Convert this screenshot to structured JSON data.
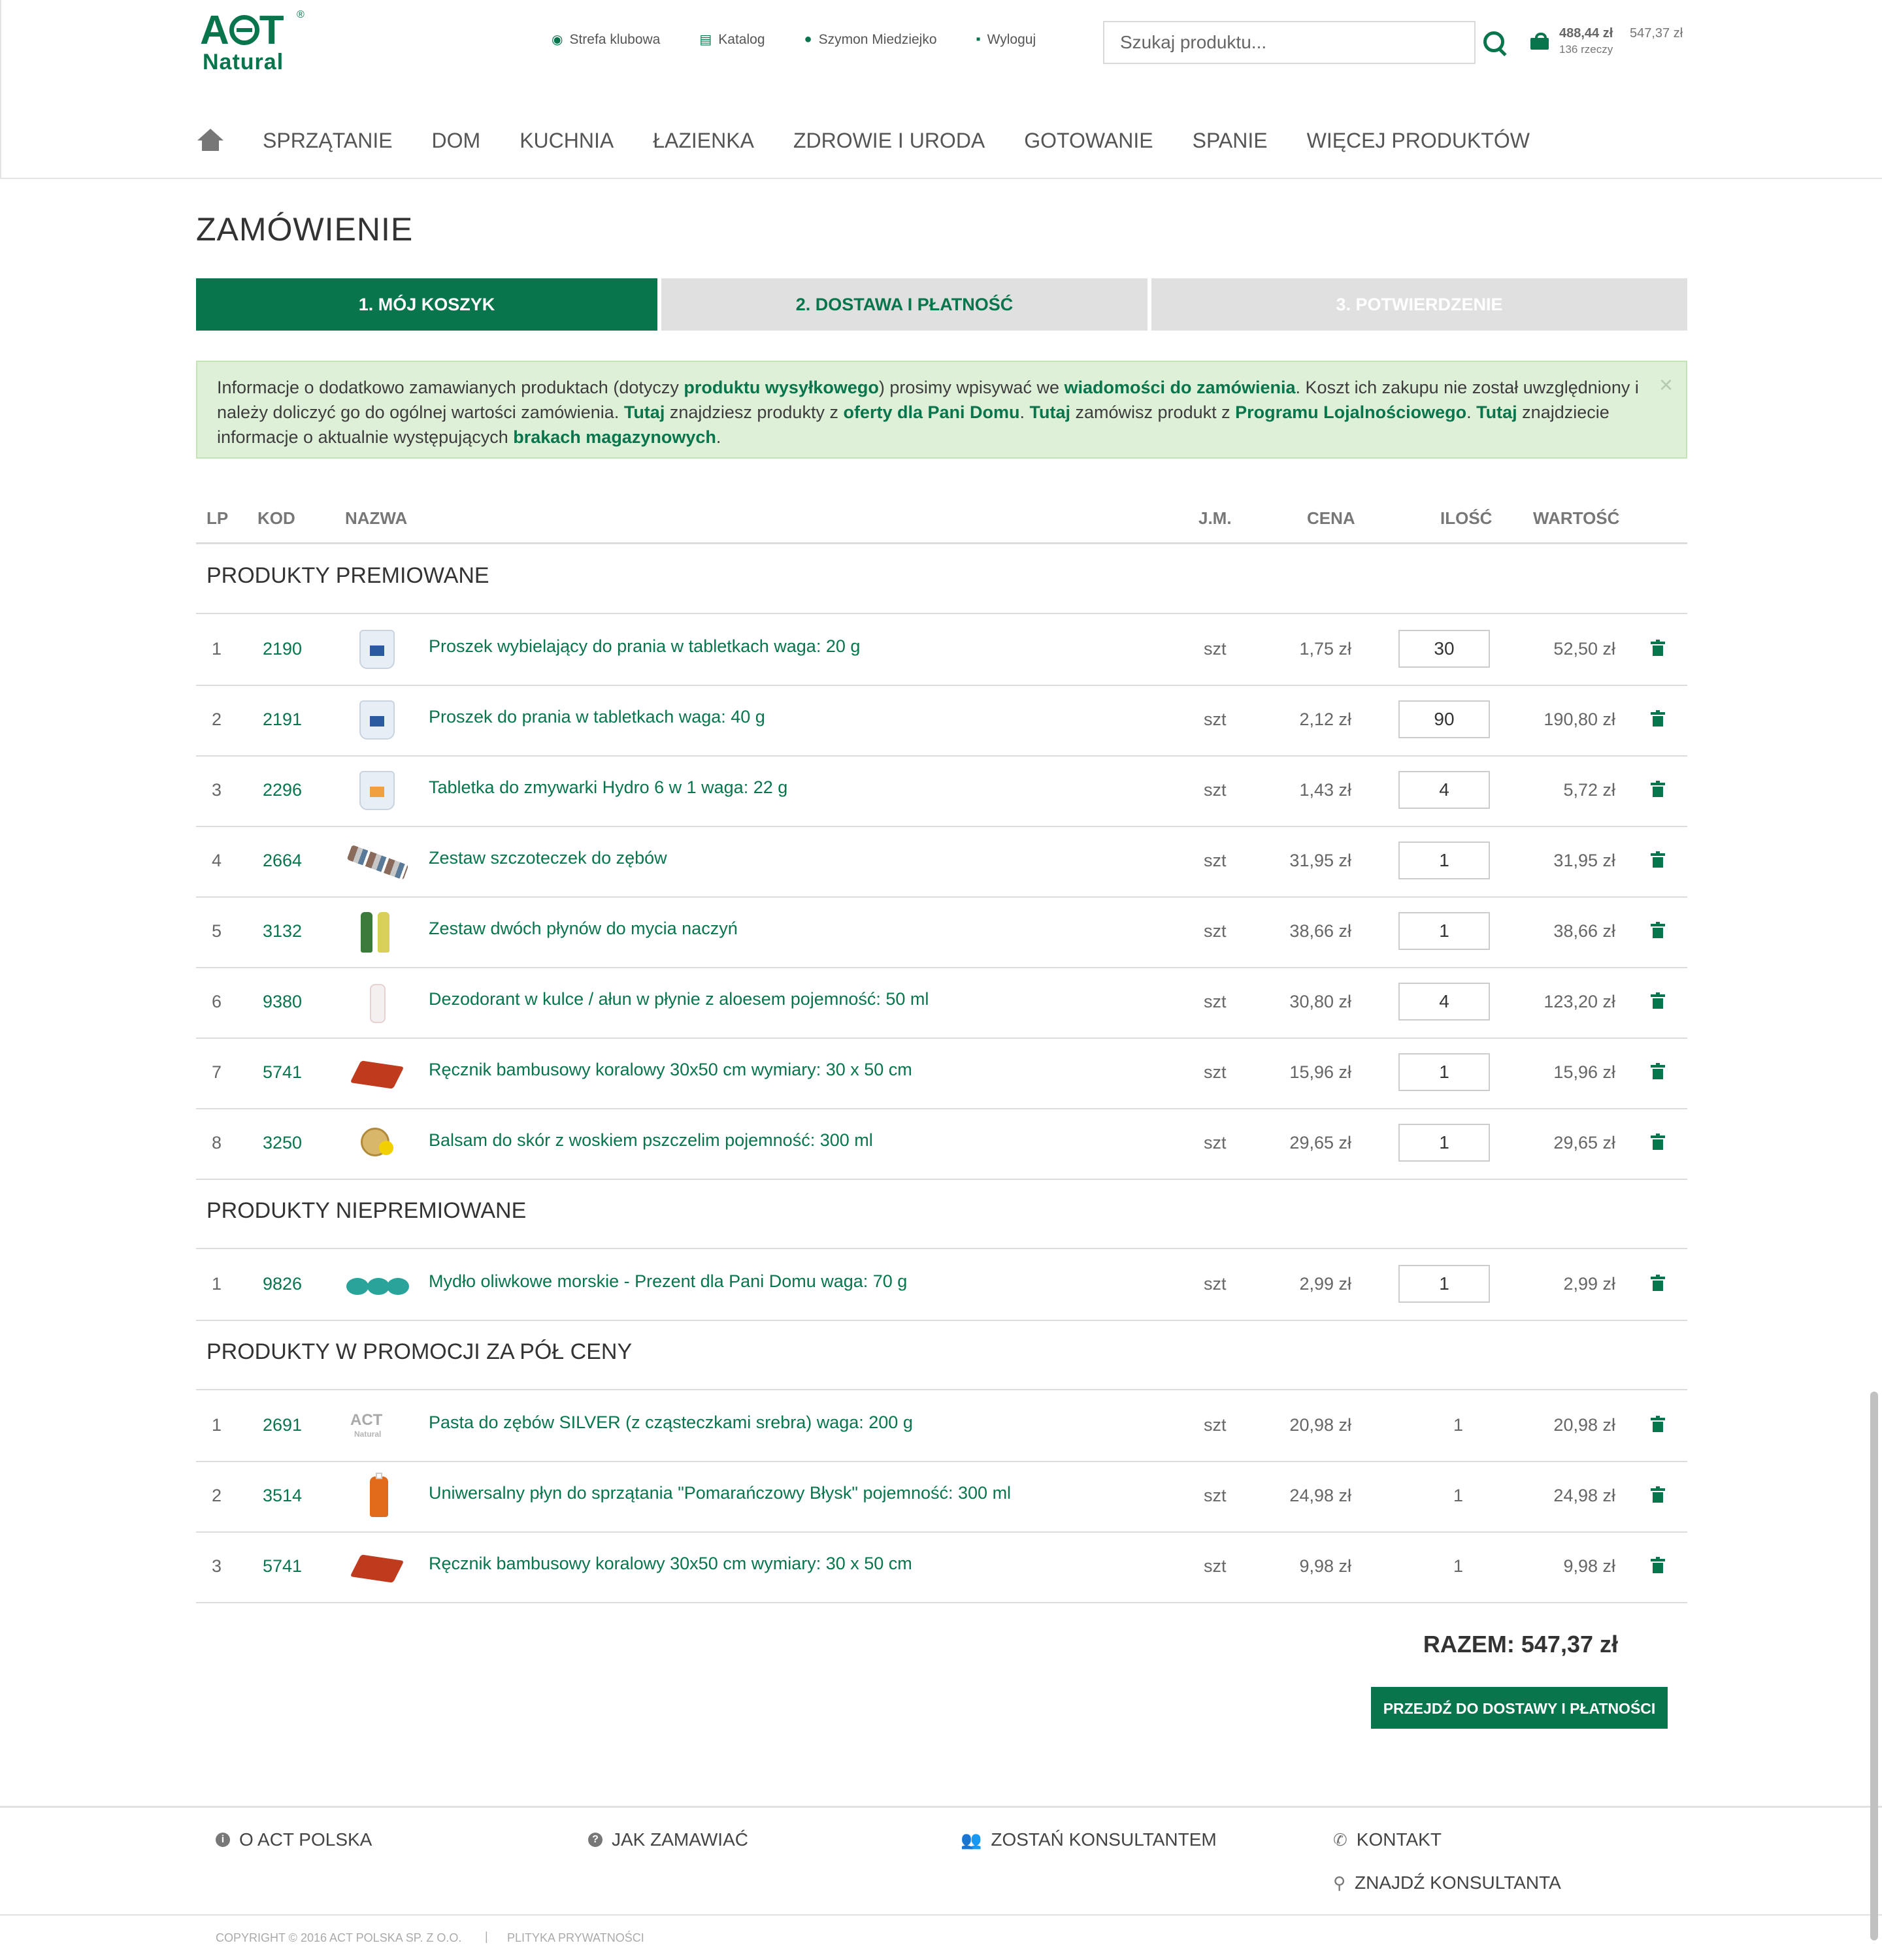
{
  "brand": {
    "logo_top": "ACT",
    "logo_bottom": "Natural",
    "accent": "#08754c"
  },
  "toplinks": {
    "club": "Strefa klubowa",
    "catalog": "Katalog",
    "user": "Szymon Miedziejko",
    "logout": "Wyloguj"
  },
  "search": {
    "placeholder": "Szukaj produktu..."
  },
  "cart": {
    "sum": "488,44 zł",
    "count": "136 rzeczy",
    "total": "547,37 zł"
  },
  "nav": [
    "SPRZĄTANIE",
    "DOM",
    "KUCHNIA",
    "ŁAZIENKA",
    "ZDROWIE I URODA",
    "GOTOWANIE",
    "SPANIE",
    "WIĘCEJ PRODUKTÓW"
  ],
  "page_title": "ZAMÓWIENIE",
  "steps": [
    "1. MÓJ KOSZYK",
    "2. DOSTAWA I PŁATNOŚĆ",
    "3. POTWIERDZENIE"
  ],
  "info": {
    "t1": "Informacje o dodatkowo zamawianych produktach (dotyczy ",
    "b1": "produktu wysyłkowego",
    "t2": ") prosimy wpisywać we ",
    "b2": "wiadomości do zamówienia",
    "t3": ". Koszt ich zakupu nie został uwzględniony i należy doliczyć go do ogólnej wartości zamówienia. ",
    "b3": "Tutaj",
    "t4": " znajdziesz produkty z ",
    "b4": "oferty dla Pani Domu",
    "t5": ". ",
    "b5": "Tutaj",
    "t6": " zamówisz produkt z ",
    "b6": "Programu Lojalnościowego",
    "t7": ". ",
    "b7": "Tutaj",
    "t8": " znajdziecie informacje o aktualnie występujących ",
    "b8": "brakach magazynowych",
    "t9": ".",
    "close": "×"
  },
  "table": {
    "headers": {
      "lp": "LP",
      "kod": "KOD",
      "nazwa": "NAZWA",
      "jm": "J.M.",
      "cena": "CENA",
      "ilosc": "ILOŚĆ",
      "wartosc": "WARTOŚĆ"
    },
    "sections": [
      {
        "title": "PRODUKTY PREMIOWANE",
        "rows": [
          {
            "lp": "1",
            "kod": "2190",
            "name": "Proszek wybielający do prania w tabletkach waga: 20 g",
            "jm": "szt",
            "cena": "1,75 zł",
            "qty": "30",
            "war": "52,50 zł",
            "thumb": "tub-blue"
          },
          {
            "lp": "2",
            "kod": "2191",
            "name": "Proszek do prania w tabletkach waga: 40 g",
            "jm": "szt",
            "cena": "2,12 zł",
            "qty": "90",
            "war": "190,80 zł",
            "thumb": "tub-blue"
          },
          {
            "lp": "3",
            "kod": "2296",
            "name": "Tabletka do zmywarki Hydro 6 w 1 waga: 22 g",
            "jm": "szt",
            "cena": "1,43 zł",
            "qty": "4",
            "war": "5,72 zł",
            "thumb": "tub-orange"
          },
          {
            "lp": "4",
            "kod": "2664",
            "name": "Zestaw szczoteczek do zębów",
            "jm": "szt",
            "cena": "31,95 zł",
            "qty": "1",
            "war": "31,95 zł",
            "thumb": "brushes"
          },
          {
            "lp": "5",
            "kod": "3132",
            "name": "Zestaw dwóch płynów do mycia naczyń",
            "jm": "szt",
            "cena": "38,66 zł",
            "qty": "1",
            "war": "38,66 zł",
            "thumb": "bottles"
          },
          {
            "lp": "6",
            "kod": "9380",
            "name": "Dezodorant w kulce / ałun w płynie z aloesem pojemność: 50 ml",
            "jm": "szt",
            "cena": "30,80 zł",
            "qty": "4",
            "war": "123,20 zł",
            "thumb": "deo"
          },
          {
            "lp": "7",
            "kod": "5741",
            "name": "Ręcznik bambusowy koralowy 30x50 cm wymiary: 30 x 50 cm",
            "jm": "szt",
            "cena": "15,96 zł",
            "qty": "1",
            "war": "15,96 zł",
            "thumb": "towel"
          },
          {
            "lp": "8",
            "kod": "3250",
            "name": "Balsam do skór z woskiem pszczelim pojemność: 300 ml",
            "jm": "szt",
            "cena": "29,65 zł",
            "qty": "1",
            "war": "29,65 zł",
            "thumb": "balm"
          }
        ]
      },
      {
        "title": "PRODUKTY NIEPREMIOWANE",
        "rows": [
          {
            "lp": "1",
            "kod": "9826",
            "name": "Mydło oliwkowe morskie - Prezent dla Pani Domu waga: 70 g",
            "jm": "szt",
            "cena": "2,99 zł",
            "qty": "1",
            "war": "2,99 zł",
            "thumb": "soap"
          }
        ]
      },
      {
        "title": "PRODUKTY W PROMOCJI ZA PÓŁ CENY",
        "rows": [
          {
            "lp": "1",
            "kod": "2691",
            "name": "Pasta do zębów SILVER (z cząsteczkami srebra) waga: 200 g",
            "jm": "szt",
            "cena": "20,98 zł",
            "qty_static": "1",
            "war": "20,98 zł",
            "thumb": "act"
          },
          {
            "lp": "2",
            "kod": "3514",
            "name": "Uniwersalny płyn do sprzątania \"Pomarańczowy Błysk\" pojemność: 300 ml",
            "jm": "szt",
            "cena": "24,98 zł",
            "qty_static": "1",
            "war": "24,98 zł",
            "thumb": "orange-bottle"
          },
          {
            "lp": "3",
            "kod": "5741",
            "name": "Ręcznik bambusowy koralowy 30x50 cm wymiary: 30 x 50 cm",
            "jm": "szt",
            "cena": "9,98 zł",
            "qty_static": "1",
            "war": "9,98 zł",
            "thumb": "towel"
          }
        ]
      }
    ]
  },
  "total": "RAZEM: 547,37 zł",
  "cta": "PRZEJDŹ DO DOSTAWY I PŁATNOŚCI",
  "footer": {
    "about": "O ACT POLSKA",
    "how": "JAK ZAMAWIAĆ",
    "become": "ZOSTAŃ KONSULTANTEM",
    "contact": "KONTAKT",
    "find": "ZNAJDŹ KONSULTANTA",
    "copyright": "COPYRIGHT © 2016 ACT POLSKA SP. Z O.O.",
    "separator": "|",
    "privacy": "PLITYKA PRYWATNOŚCI"
  }
}
